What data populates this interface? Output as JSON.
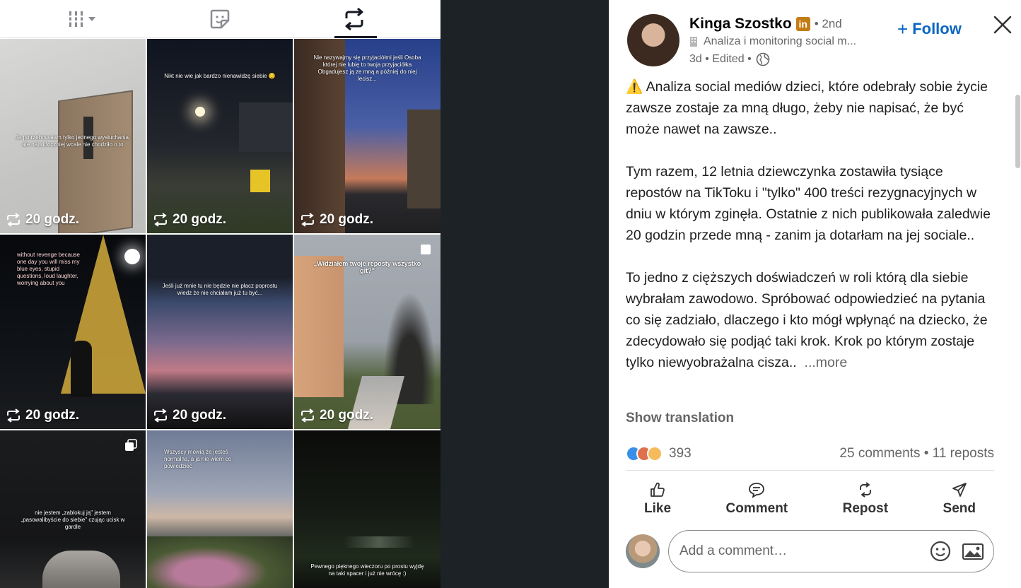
{
  "left_panel": {
    "tabs": [
      {
        "name": "grid-view",
        "icon": "grid-columns-icon"
      },
      {
        "name": "favorites",
        "icon": "sticker-icon"
      },
      {
        "name": "reposts",
        "icon": "repost-icon",
        "active": true
      }
    ],
    "tiles": [
      {
        "caption": "Ja potrzebowałam tylko jednego wysłuchania, ale najwidoczniej wcale nie chodziło o to",
        "meta": "20 godz."
      },
      {
        "caption": "Nikt nie wie jak bardzo nienawidzę siebie 😔",
        "meta": "20 godz."
      },
      {
        "caption": "Nie nazywajmy się przyjaciółmi jeśli Osoba której nie lubię to twoja przyjaciółka Obgadujesz ją ze mną a później do niej lecisz...",
        "meta": "20 godz."
      },
      {
        "caption": "without revenge because one day you will miss my blue eyes, stupid questions, loud laughter, worrying about you",
        "meta": "20 godz."
      },
      {
        "caption": "Jeśli już mnie tu nie będzie nie płacz poprostu wiedz że nie chciałam już tu być...",
        "meta": "20 godz."
      },
      {
        "caption": "„Widziałem twoje reposty wszystko git?\"",
        "meta": "20 godz."
      },
      {
        "caption": "nie jestem „zablokuj ją\" jestem „pasowalibyście do siebie\" czując ucisk w gardle",
        "meta": ""
      },
      {
        "caption": "Wszyscy mówią że jesteś normalna, a ja nie wiem co powiedzieć",
        "meta": ""
      },
      {
        "caption": "Pewnego pięknego wieczoru po prostu wyjdę na taki spacer i już nie wrócę :)",
        "meta": ""
      }
    ]
  },
  "post": {
    "author": "Kinga Szostko",
    "badge": "in",
    "degree": "• 2nd",
    "headline": "Analiza i monitoring social m...",
    "time": "3d • Edited •",
    "follow_label": "Follow",
    "paragraphs": [
      "⚠️ Analiza social mediów dzieci, które odebrały sobie życie zawsze zostaje za mną długo, żeby nie napisać, że być może nawet na zawsze..",
      "Tym razem, 12 letnia dziewczynka zostawiła tysiące repostów na TikToku i \"tylko\" 400 treści rezygnacyjnych w dniu w którym zginęła. Ostatnie z nich publikowała zaledwie 20 godzin przede mną - zanim ja dotarłam na jej sociale..",
      "To jedno z cięższych doświadczeń w roli którą dla siebie wybrałam zawodowo. Spróbować odpowiedzieć na pytania co się zadziało, dlaczego i kto mógł wpłynąć na dziecko, że zdecydowało się podjąć taki krok. Krok po którym zostaje tylko niewyobrażalna cisza.."
    ],
    "more_label": "...more",
    "show_translation": "Show translation",
    "reactions_count": "393",
    "comments_reposts": "25 comments • 11 reposts",
    "actions": {
      "like": "Like",
      "comment": "Comment",
      "repost": "Repost",
      "send": "Send"
    },
    "comment_placeholder": "Add a comment…"
  }
}
